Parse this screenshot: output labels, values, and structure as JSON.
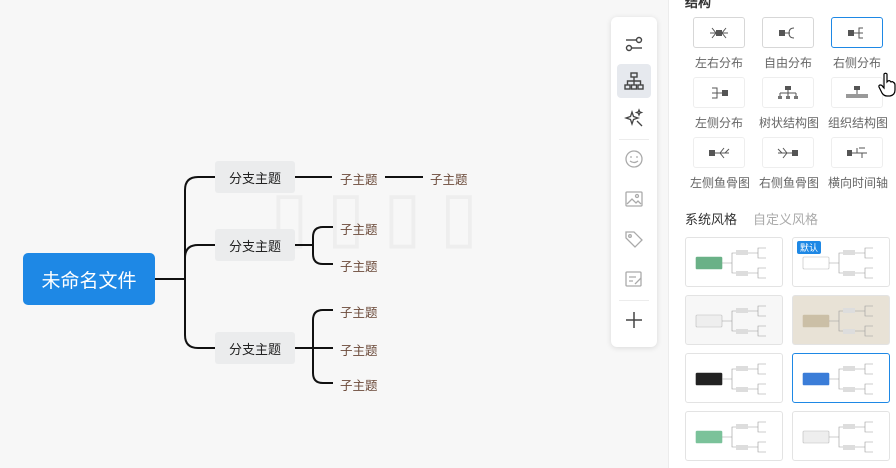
{
  "mindmap": {
    "central": "未命名文件",
    "branches": [
      {
        "label": "分支主题",
        "children": [
          "子主题"
        ],
        "grandchild": "子主题"
      },
      {
        "label": "分支主题",
        "children": [
          "子主题",
          "子主题"
        ]
      },
      {
        "label": "分支主题",
        "children": [
          "子主题",
          "子主题",
          "子主题"
        ]
      }
    ]
  },
  "toolbar": {
    "items": [
      {
        "name": "settings-sliders-icon",
        "active": false
      },
      {
        "name": "structure-icon",
        "active": true
      },
      {
        "name": "sparkle-style-icon",
        "active": false
      },
      {
        "name": "emoji-icon",
        "active": false
      },
      {
        "name": "image-icon",
        "active": false
      },
      {
        "name": "tag-icon",
        "active": false
      },
      {
        "name": "note-icon",
        "active": false
      },
      {
        "name": "plus-icon",
        "active": false
      }
    ]
  },
  "panel": {
    "section_title": "结构",
    "layouts": [
      {
        "label": "左右分布",
        "selected": false
      },
      {
        "label": "自由分布",
        "selected": false
      },
      {
        "label": "右侧分布",
        "selected": true
      },
      {
        "label": "左侧分布",
        "selected": false
      },
      {
        "label": "树状结构图",
        "selected": false
      },
      {
        "label": "组织结构图",
        "selected": false
      },
      {
        "label": "左侧鱼骨图",
        "selected": false
      },
      {
        "label": "右侧鱼骨图",
        "selected": false
      },
      {
        "label": "横向时间轴",
        "selected": false
      }
    ],
    "tabs": {
      "system": "系统风格",
      "custom": "自定义风格"
    },
    "styles": [
      {
        "bg": "#ffffff",
        "center": "#6ab187",
        "selected": false,
        "badge": ""
      },
      {
        "bg": "#ffffff",
        "center": "#ffffff",
        "selected": false,
        "badge": "默认"
      },
      {
        "bg": "#f7f7f7",
        "center": "#eeeeee",
        "selected": false,
        "badge": ""
      },
      {
        "bg": "#e8e2d6",
        "center": "#cbbfa6",
        "selected": false,
        "badge": ""
      },
      {
        "bg": "#ffffff",
        "center": "#222222",
        "selected": false,
        "badge": ""
      },
      {
        "bg": "#ffffff",
        "center": "#3b7dd8",
        "selected": true,
        "badge": ""
      },
      {
        "bg": "#ffffff",
        "center": "#7bc29a",
        "selected": false,
        "badge": ""
      },
      {
        "bg": "#ffffff",
        "center": "#eeeeee",
        "selected": false,
        "badge": ""
      }
    ],
    "accent": "#1e88e5"
  }
}
